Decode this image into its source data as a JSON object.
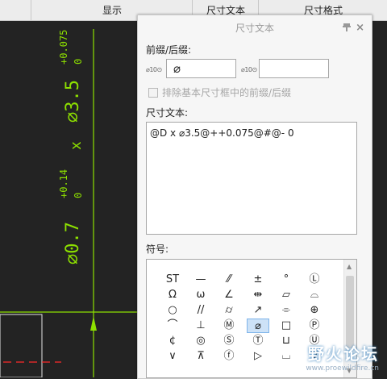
{
  "tabs": [
    "显示",
    "尺寸文本",
    "尺寸格式"
  ],
  "drawing": {
    "dim_top": "⌀3.5",
    "dim_top_tol_upper": "+0.075",
    "dim_top_tol_lower": "0",
    "dim_x": "x",
    "dim_bottom": "⌀0.7",
    "dim_bottom_tol_upper": "+0.14",
    "dim_bottom_tol_lower": "0",
    "line_color": "#8de000"
  },
  "panel": {
    "title": "尺寸文本",
    "prefix_suffix_label": "前缀/后缀:",
    "prefix_icon": "⌀10⊙",
    "prefix_value": "⌀",
    "suffix_icon": "⌀10⊙",
    "suffix_value": "",
    "exclude_checkbox_label": "排除基本尺寸框中的前缀/后缀",
    "dim_text_label": "尺寸文本:",
    "dim_text_value": "@D x ⌀3.5@++0.075@#@- 0",
    "symbols_label": "符号:",
    "symbols": [
      [
        "ST",
        "—",
        "⁄⁄",
        "±",
        "°",
        "Ⓛ"
      ],
      [
        "Ω",
        "ω",
        "∠",
        "⇹",
        "▱",
        "⌓"
      ],
      [
        "○",
        "//",
        "⌭",
        "↗",
        "⌯",
        "⊕"
      ],
      [
        "⌒",
        "⊥",
        "Ⓜ",
        "⌀",
        "□",
        "Ⓟ"
      ],
      [
        "¢",
        "◎",
        "Ⓢ",
        "Ⓣ",
        "⊔",
        "Ⓤ"
      ],
      [
        "∨",
        "⊼",
        "ⓕ",
        "▷",
        "⌴",
        "∇"
      ]
    ],
    "selected_symbol": "⌀"
  },
  "watermark": {
    "name": "野火论坛",
    "url": "www.proewildfire.cn"
  }
}
